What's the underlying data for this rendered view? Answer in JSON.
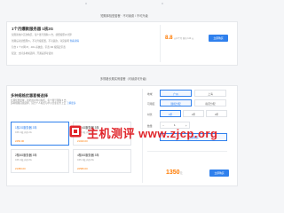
{
  "topbar": {
    "label": ""
  },
  "section1": {
    "title": "短期体验型套餐 · 不可续费 / 不可升级",
    "card": {
      "title": "1个月爆款服务器 1核2G",
      "desc": [
        "仅限新用户首次购买，每个账号限购 1 台，续费按原价计算",
        "到期后可续费原价，不可升级配置，不可退款，详见说明",
        "包含 1 个公网 IP，40G 系统盘，带宽 3M 按固定带宽",
        "配送：支持多地域选择，开通后即可使用"
      ],
      "link": "查看详情",
      "price": "8.8",
      "price_note": "元/1个月 原价 120 元",
      "buy_label": "立即购买"
    }
  },
  "section2": {
    "title": "多规格长期实例套餐（可续费可升级）",
    "card": {
      "title": "多种规格优惠套餐选择",
      "desc": [
        "长期优惠套餐，新老用户均可购买，每个账号限购 5 台",
        "多种规格自由选择，适合个人站长与中小企业业务上云"
      ],
      "link": "了解更多",
      "plans": [
        {
          "name": "1核2G服务器 3年",
          "sub": "CPU 1核 内存 2G",
          "price": "¥450.00",
          "selected": true
        },
        {
          "name": "2核4G服务器 3年",
          "sub": "CPU 2核 内存 4G",
          "price": "¥1020.00",
          "selected": false
        },
        {
          "name": "2核8G服务器 3年",
          "sub": "CPU 2核 内存 8G",
          "price": "¥1350.00",
          "selected": false
        },
        {
          "name": "4核8G服务器 3年",
          "sub": "CPU 4核 内存 8G",
          "price": "¥2580.00",
          "selected": false
        }
      ],
      "form": {
        "region_label": "地域",
        "regions": [
          "广州",
          "上海"
        ],
        "zone_label": "可用区",
        "zones": [
          "随机分配",
          "指定分配"
        ],
        "duration_label": "时长",
        "durations": [
          "1年",
          "2年",
          "3年"
        ],
        "qty_label": "数量",
        "qty": "1",
        "cart_label": "立即购买"
      },
      "price": "1350",
      "price_unit": "元",
      "buy_label": "立即购买"
    }
  },
  "watermark": {
    "text": "主机测评 www.zjcp.org"
  }
}
